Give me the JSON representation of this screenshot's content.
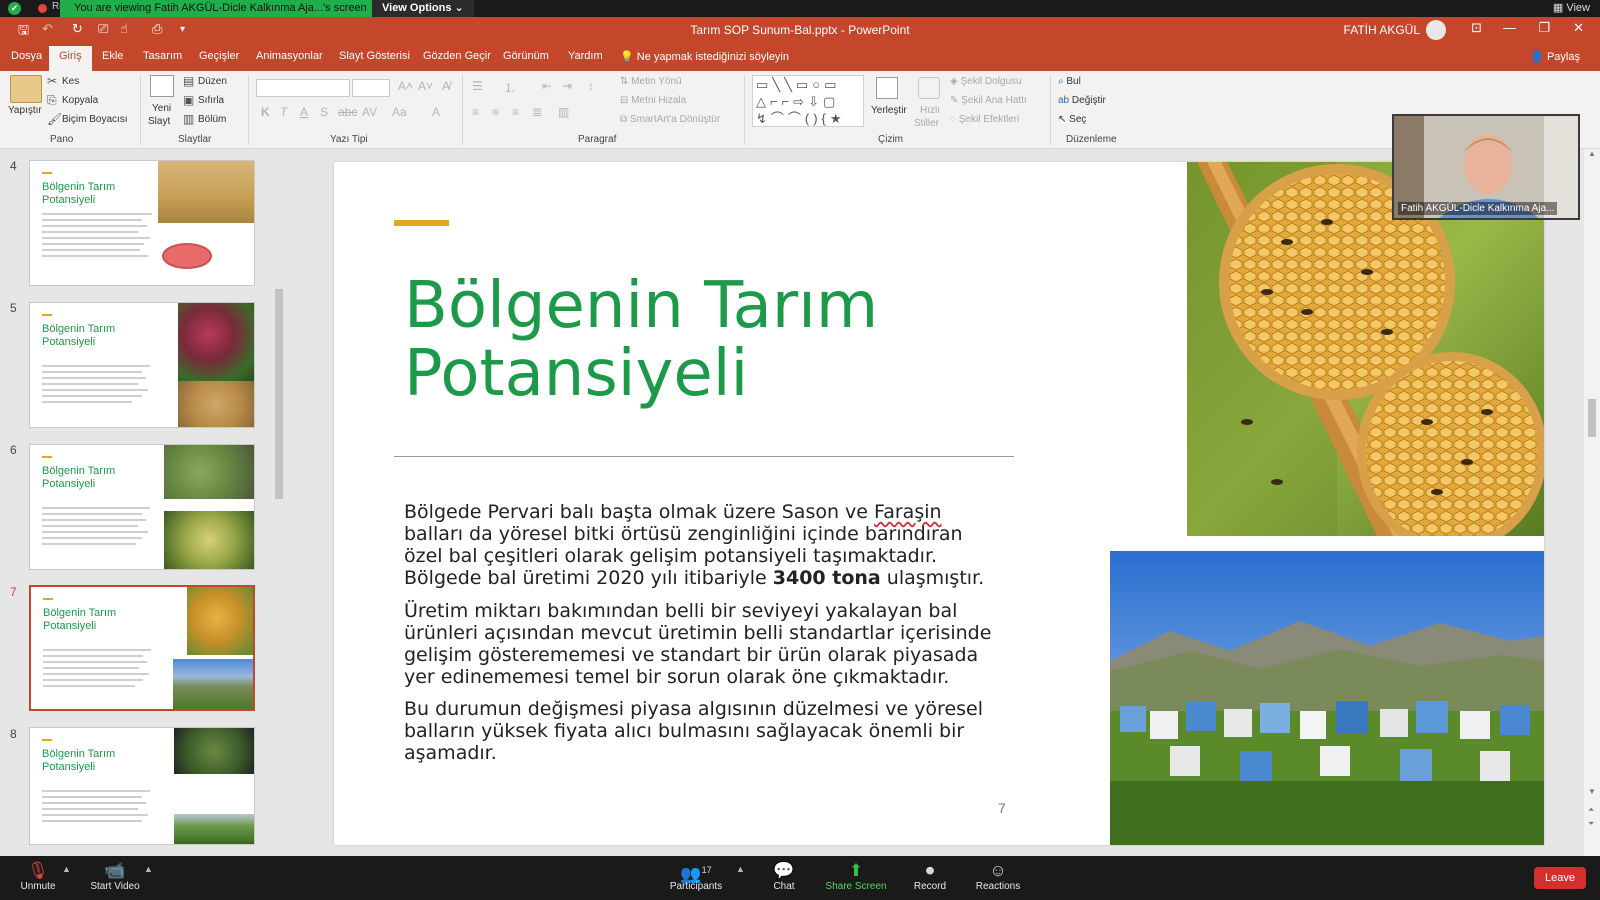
{
  "zoom": {
    "recording_label": "Recording",
    "share_banner": "You are viewing Fatih AKGÜL-Dicle Kalkınma Aja...'s screen",
    "view_options": "View Options ⌄",
    "view_label": "View",
    "participants_count": "17",
    "toolbar": {
      "unmute": "Unmute",
      "start_video": "Start Video",
      "participants": "Participants",
      "chat": "Chat",
      "share_screen": "Share Screen",
      "record": "Record",
      "reactions": "Reactions",
      "leave": "Leave"
    },
    "camera_name": "Fatih AKGÜL-Dicle Kalkınma Aja..."
  },
  "ppt": {
    "doc_title": "Tarım SOP Sunum-Bal.pptx  -  PowerPoint",
    "user_name": "FATİH AKGÜL",
    "tabs": [
      "Dosya",
      "Giriş",
      "Ekle",
      "Tasarım",
      "Geçişler",
      "Animasyonlar",
      "Slayt Gösterisi",
      "Gözden Geçir",
      "Görünüm",
      "Yardım"
    ],
    "tell_me": "Ne yapmak istediğinizi söyleyin",
    "share": "Paylaş",
    "ribbon": {
      "pano": {
        "label": "Pano",
        "paste": "Yapıştır",
        "cut": "Kes",
        "copy": "Kopyala",
        "format_painter": "Biçim Boyacısı"
      },
      "slaytlar": {
        "label": "Slaytlar",
        "new_slide": "Yeni",
        "new_slide2": "Slayt",
        "layout": "Düzen",
        "reset": "Sıfırla",
        "section": "Bölüm"
      },
      "yazi_tipi": {
        "label": "Yazı Tipi"
      },
      "paragraf": {
        "label": "Paragraf",
        "text_dir": "Metin Yönü",
        "align_text": "Metni Hizala",
        "smartart": "SmartArt'a Dönüştür"
      },
      "cizim": {
        "label": "Çizim",
        "arrange": "Yerleştir",
        "quick_styles": "Hızlı",
        "quick_styles2": "Stiller",
        "fill": "Şekil Dolgusu",
        "outline": "Şekil Ana Hattı",
        "effects": "Şekil Efektleri"
      },
      "duzenleme": {
        "label": "Düzenleme",
        "find": "Bul",
        "replace": "Değiştir",
        "select": "Seç"
      }
    },
    "thumbnails": [
      {
        "num": "4",
        "title": "Bölgenin Tarım Potansiyeli"
      },
      {
        "num": "5",
        "title": "Bölgenin Tarım Potansiyeli"
      },
      {
        "num": "6",
        "title": "Bölgenin Tarım Potansiyeli"
      },
      {
        "num": "7",
        "title": "Bölgenin Tarım Potansiyeli"
      },
      {
        "num": "8",
        "title": "Bölgenin Tarım Potansiyeli"
      }
    ],
    "slide": {
      "title_line1": "Bölgenin Tarım",
      "title_line2": "Potansiyeli",
      "p1_a": "Bölgede Pervari balı başta olmak üzere Sason ve ",
      "p1_spell": "Faraşin",
      "p1_b": " balları da yöresel bitki örtüsü zenginliğini içinde barındıran özel bal çeşitleri olarak gelişim potansiyeli taşımaktadır. Bölgede bal üretimi 2020 yılı itibariyle ",
      "p1_bold": "3400 tona",
      "p1_c": " ulaşmıştır.",
      "p2": "Üretim miktarı bakımından belli bir seviyeyi yakalayan bal ürünleri açısından mevcut üretimin belli standartlar içerisinde gelişim gösterememesi ve standart bir ürün olarak piyasada yer edinememesi temel bir sorun olarak öne çıkmaktadır.",
      "p3": "Bu durumun değişmesi piyasa algısının düzelmesi ve yöresel balların yüksek fiyata alıcı bulmasını sağlayacak önemli bir aşamadır.",
      "number": "7"
    }
  }
}
